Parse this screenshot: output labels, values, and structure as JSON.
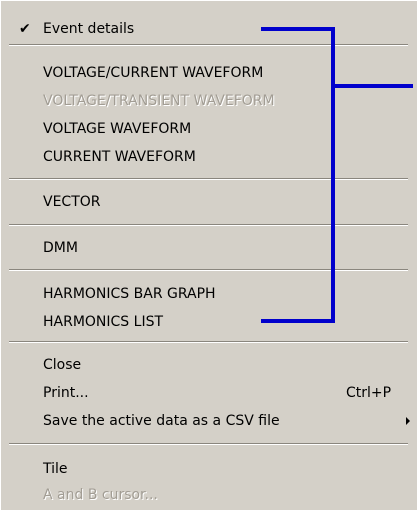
{
  "menu": {
    "event_details": {
      "label": "Event details",
      "checked": true,
      "check_glyph": "✔"
    },
    "vi_waveform": {
      "label": "VOLTAGE/CURRENT WAVEFORM"
    },
    "vt_waveform": {
      "label": "VOLTAGE/TRANSIENT WAVEFORM",
      "disabled": true
    },
    "v_waveform": {
      "label": "VOLTAGE WAVEFORM"
    },
    "i_waveform": {
      "label": "CURRENT WAVEFORM"
    },
    "vector": {
      "label": "VECTOR"
    },
    "dmm": {
      "label": "DMM"
    },
    "harm_bar": {
      "label": "HARMONICS BAR GRAPH"
    },
    "harm_list": {
      "label": "HARMONICS LIST"
    },
    "close": {
      "label": "Close"
    },
    "print": {
      "label": "Print...",
      "shortcut": "Ctrl+P"
    },
    "save_csv": {
      "label": "Save the active data as a CSV file",
      "has_submenu": true
    },
    "tile": {
      "label": "Tile"
    },
    "ab_cursor": {
      "label": "A and B cursor...",
      "disabled": true
    }
  },
  "colors": {
    "menu_background": "#d4d0c8",
    "disabled_text": "#a29d94",
    "bracket": "#0000cc"
  }
}
